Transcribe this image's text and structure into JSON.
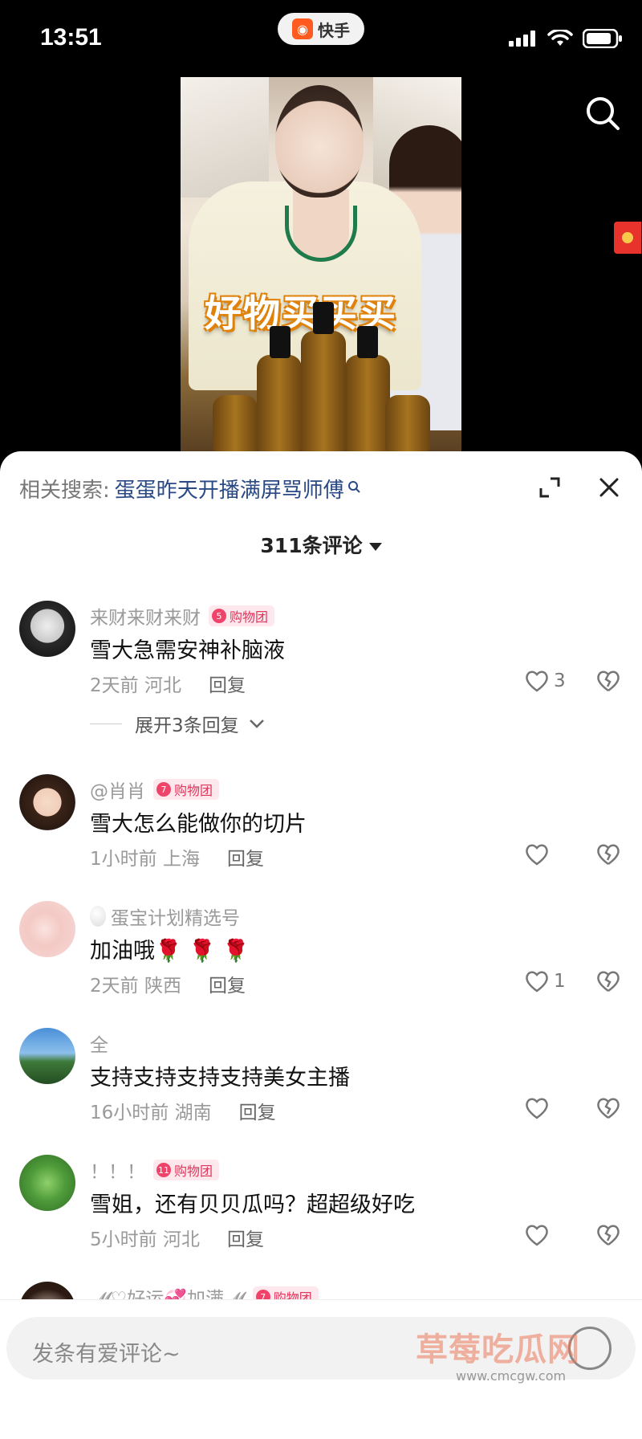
{
  "status_bar": {
    "time": "13:51",
    "app_name": "快手"
  },
  "video": {
    "caption": "好物买买买"
  },
  "sheet": {
    "related_label": "相关搜索:",
    "related_keyword": "蛋蛋昨天开播满屏骂师傅",
    "comment_count": "311条评论"
  },
  "comments": [
    {
      "user": "来财来财来财",
      "badge_level": "5",
      "badge": "购物团",
      "text": "雪大急需安神补脑液",
      "time": "2天前",
      "location": "河北",
      "reply": "回复",
      "likes": "3"
    },
    {
      "user": "@肖肖",
      "badge_level": "7",
      "badge": "购物团",
      "text": "雪大怎么能做你的切片",
      "time": "1小时前",
      "location": "上海",
      "reply": "回复",
      "likes": ""
    },
    {
      "user": "蛋宝计划精选号",
      "badge_level": "",
      "badge": "",
      "text": "加油哦🌹 🌹 🌹",
      "time": "2天前",
      "location": "陕西",
      "reply": "回复",
      "likes": "1"
    },
    {
      "user": "全",
      "badge_level": "",
      "badge": "",
      "text": "支持支持支持支持美女主播",
      "time": "16小时前",
      "location": "湖南",
      "reply": "回复",
      "likes": ""
    },
    {
      "user": "！！！",
      "badge_level": "11",
      "badge": "购物团",
      "text": "雪姐，还有贝贝瓜吗？超超级好吃",
      "time": "5小时前",
      "location": "河北",
      "reply": "回复",
      "likes": ""
    },
    {
      "user": "𝓜♡好运💞加满𝓜",
      "badge_level": "7",
      "badge": "购物团",
      "text": "",
      "time": "",
      "location": "",
      "reply": "",
      "likes": ""
    }
  ],
  "expand_replies": "展开3条回复",
  "input": {
    "placeholder": "发条有爱评论~"
  },
  "watermark": {
    "title": "草莓吃瓜网",
    "url": "www.cmcgw.com"
  },
  "colors": {
    "accent_badge": "#f0436a",
    "link": "#2a4a86",
    "app_logo": "#ff5a1f"
  }
}
